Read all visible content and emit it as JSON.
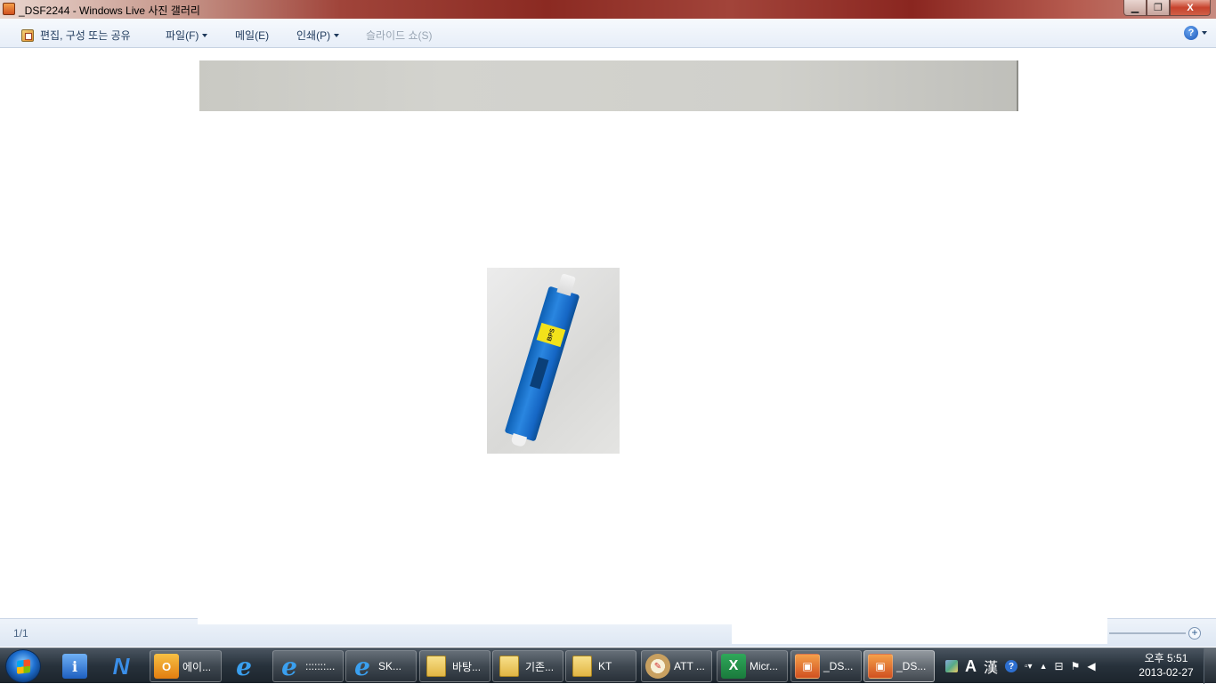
{
  "window": {
    "title": "_DSF2244 - Windows Live 사진 갤러리",
    "minimize": "▁",
    "maximize": "❐",
    "close": "X"
  },
  "menubar": {
    "items": [
      {
        "label": "편집, 구성 또는 공유",
        "has_dropdown": false,
        "enabled": true
      },
      {
        "label": "파일(F)",
        "has_dropdown": true,
        "enabled": true
      },
      {
        "label": "메일(E)",
        "has_dropdown": false,
        "enabled": true
      },
      {
        "label": "인쇄(P)",
        "has_dropdown": true,
        "enabled": true
      },
      {
        "label": "슬라이드 쇼(S)",
        "has_dropdown": false,
        "enabled": false
      }
    ],
    "help_icon": "?"
  },
  "viewer": {
    "photo_label_text": "BPS"
  },
  "statusbar": {
    "counter": "1/1",
    "zoom_plus": "+"
  },
  "taskbar": {
    "buttons": [
      {
        "label": "",
        "icon": "info-app-icon",
        "glyph": "i"
      },
      {
        "label": "",
        "icon": "n-app-icon",
        "glyph": "N"
      },
      {
        "label": "에이...",
        "icon": "outlook-icon",
        "glyph": "O"
      },
      {
        "label": "",
        "icon": "ie-icon",
        "glyph": "e"
      },
      {
        "label": ":::::::...",
        "icon": "ie-icon",
        "glyph": "e"
      },
      {
        "label": "SK...",
        "icon": "ie-icon",
        "glyph": "e"
      },
      {
        "label": "바탕...",
        "icon": "folder-icon",
        "glyph": ""
      },
      {
        "label": "기존...",
        "icon": "folder-icon",
        "glyph": ""
      },
      {
        "label": "KT",
        "icon": "folder-icon",
        "glyph": ""
      },
      {
        "label": "ATT ...",
        "icon": "paint-icon",
        "glyph": "✎"
      },
      {
        "label": "Micr...",
        "icon": "excel-icon",
        "glyph": "X"
      },
      {
        "label": "_DS...",
        "icon": "photo-gallery-icon",
        "glyph": "▣"
      },
      {
        "label": "_DS...",
        "icon": "photo-gallery-icon",
        "glyph": "▣"
      }
    ],
    "tray": {
      "ime_a": "A",
      "ime_han": "漢",
      "help": "?"
    },
    "clock": {
      "time": "오후 5:51",
      "date": "2013-02-27"
    }
  }
}
